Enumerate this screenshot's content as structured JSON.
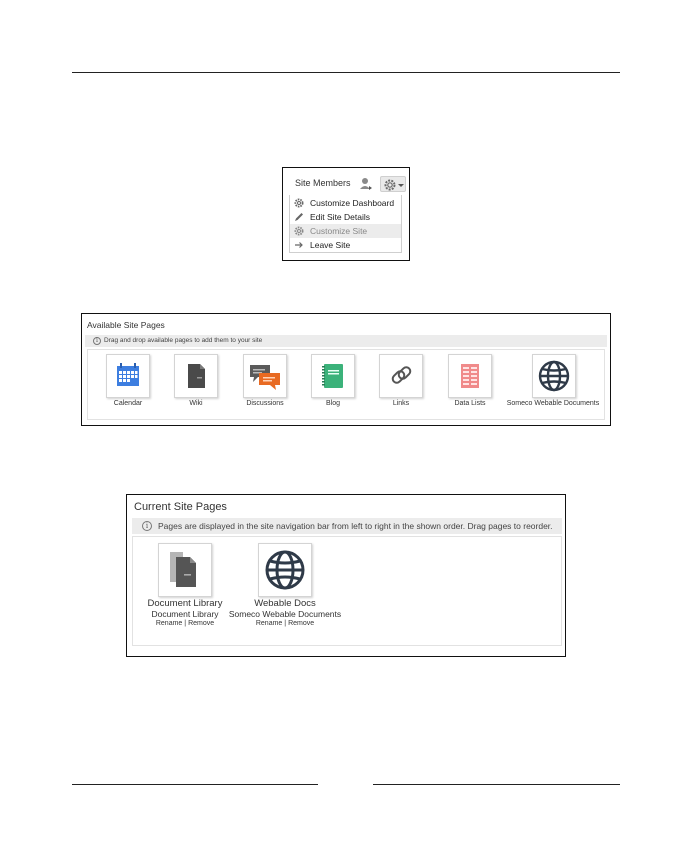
{
  "site_members": {
    "title": "Site Members",
    "menu": [
      {
        "label": "Customize Dashboard",
        "icon": "gear-icon"
      },
      {
        "label": "Edit Site Details",
        "icon": "pencil-icon"
      },
      {
        "label": "Customize Site",
        "icon": "gear-icon",
        "disabled": true
      },
      {
        "label": "Leave Site",
        "icon": "arrow-right-icon"
      }
    ]
  },
  "available_pages": {
    "title": "Available Site Pages",
    "info": "Drag and drop available pages to add them to your site",
    "pages": [
      {
        "label": "Calendar",
        "icon": "calendar-icon"
      },
      {
        "label": "Wiki",
        "icon": "wiki-icon"
      },
      {
        "label": "Discussions",
        "icon": "discussions-icon"
      },
      {
        "label": "Blog",
        "icon": "blog-icon"
      },
      {
        "label": "Links",
        "icon": "links-icon"
      },
      {
        "label": "Data Lists",
        "icon": "data-lists-icon"
      },
      {
        "label": "Someco Webable Documents",
        "icon": "globe-icon"
      }
    ]
  },
  "current_pages": {
    "title": "Current Site Pages",
    "info": "Pages are displayed in the site navigation bar from left to right in the shown order. Drag pages to reorder.",
    "pages": [
      {
        "name": "Document Library",
        "subtitle": "Document Library",
        "rename": "Rename",
        "separator": "|",
        "remove": "Remove",
        "icon": "document-library-icon"
      },
      {
        "name": "Webable Docs",
        "subtitle": "Someco Webable Documents",
        "rename": "Rename",
        "separator": "|",
        "remove": "Remove",
        "icon": "globe-icon"
      }
    ]
  },
  "colors": {
    "calendar": "#3d7ee0",
    "discussions": "#e86a22",
    "blog": "#3bb27a",
    "data_lists": "#f08a8a",
    "globe": "#2f3a48"
  }
}
